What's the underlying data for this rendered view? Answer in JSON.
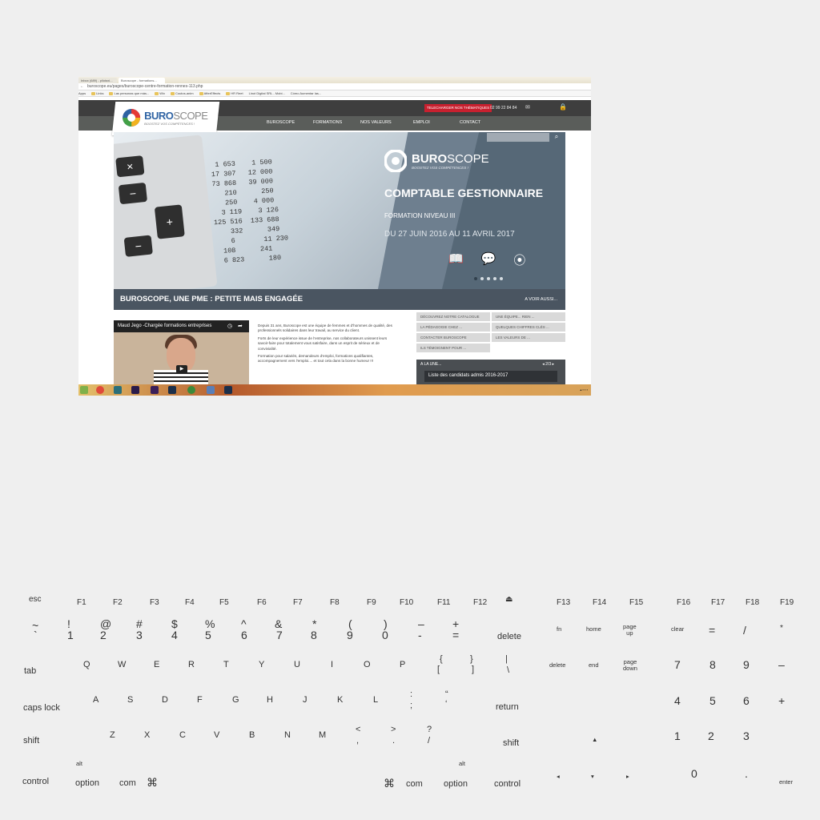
{
  "browser": {
    "tabs": [
      "Inbox (689) - pilotaxi...",
      "Buroscope - formations..."
    ],
    "url": "buroscope.eu/pages/buroscope-centre-formation-rennes-113.php",
    "bookmarks": [
      "Apps",
      "Links",
      "Las personas que más...",
      "Wix",
      "Coutos-anim",
      "AfterEffects",
      "HR Reet",
      "Linot Digital SRL - Mobi...",
      "Cómo Aumentar las..."
    ]
  },
  "site": {
    "download_button": "TELECHARGER NOS THÉMATIQUES",
    "phone": "02 99 22 84 84",
    "logo_name_bold": "BURO",
    "logo_name_light": "SCOPE",
    "logo_tagline": "BOOSTEZ VOS COMPÉTENCES !",
    "nav": [
      "BUROSCOPE",
      "FORMATIONS",
      "NOS VALEURS",
      "EMPLOI",
      "CONTACT"
    ],
    "hero": {
      "title": "COMPTABLE GESTIONNAIRE",
      "subtitle": "FORMATION NIVEAU III",
      "dates": "DU 27 JUIN 2016  AU 11 AVRIL 2017",
      "paper": "    1 653    1 500\n   17 307   12 000\n   73 868   39 000\n      210      250\n      250    4 000\n     3 119    3 126\n   125 516  133 688\n       332      349\n       6       11 230\n     108      241\n     6 823      180",
      "calc_keys": [
        "×",
        "−",
        "+",
        "−"
      ]
    },
    "banner": {
      "title": "BUROSCOPE, UNE PME : PETITE MAIS ENGAGÉE",
      "link": "A VOIR AUSSI..."
    },
    "video_title": "Maud Jego -Chargée formations entreprises",
    "body": [
      "Depuis 31 ans, Buroscope est une équipe de femmes et d'hommes de qualité, des professionnels solidaires dans leur travail, au service du client.",
      "Forts de leur expérience issue de l'entreprise, nos collaborateurs unissent leurs savoir-faire pour totalement vous satisfaire, dans un esprit de sérieux et de convivialité.",
      "Formation pour salariés, demandeurs d'emploi, formations qualifiantes, accompagnement vers l'emploi.... et tout cela dans la bonne humeur !!!"
    ],
    "links": [
      "DÉCOUVREZ NOTRE CATALOGUE",
      "UNE ÉQUIPE... RIEN ...",
      "LA PÉDAGOGIE CHEZ ...",
      "QUELQUES CHIFFRES CLÉS ...",
      "CONTACTER BUROSCOPE",
      "LES VALEURS DE ...",
      "ILS TÉMOIGNENT POUR ..."
    ],
    "alaune": {
      "label": "A LA UNE...",
      "pager": "◂ 2/3 ▸",
      "item": "Liste des candidats admis 2016-2017"
    }
  },
  "keyboard": {
    "fn_row": [
      "esc",
      "F1",
      "F2",
      "F3",
      "F4",
      "F5",
      "F6",
      "F7",
      "F8",
      "F9",
      "F10",
      "F11",
      "F12",
      "⏏",
      "F13",
      "F14",
      "F15",
      "F16",
      "F17",
      "F18",
      "F19"
    ],
    "num_row_top": [
      "~",
      "!",
      "@",
      "#",
      "$",
      "%",
      "^",
      "&",
      "*",
      "(",
      ")",
      "–",
      "+"
    ],
    "num_row_bot": [
      "`",
      "1",
      "2",
      "3",
      "4",
      "5",
      "6",
      "7",
      "8",
      "9",
      "0",
      "-",
      "="
    ],
    "delete": "delete",
    "q_row": [
      "Q",
      "W",
      "E",
      "R",
      "T",
      "Y",
      "U",
      "I",
      "O",
      "P"
    ],
    "a_row": [
      "A",
      "S",
      "D",
      "F",
      "G",
      "H",
      "J",
      "K",
      "L"
    ],
    "z_row": [
      "Z",
      "X",
      "C",
      "V",
      "B",
      "N",
      "M"
    ],
    "brackets": [
      "{",
      "}",
      "|",
      "[",
      "]",
      "\\"
    ],
    "semis": [
      ":",
      "“",
      ";",
      "‘"
    ],
    "angles": [
      "<",
      ">",
      "?",
      ",",
      ".",
      "/"
    ],
    "tab": "tab",
    "caps": "caps lock",
    "return": "return",
    "shift": "shift",
    "alt": "alt",
    "control": "control",
    "option": "option",
    "com": "com",
    "cmd": "⌘",
    "nav_keys": {
      "fn": "fn",
      "home": "home",
      "page_up": "page\nup",
      "delete": "delete",
      "end": "end",
      "page_down": "page\ndown"
    },
    "numpad": {
      "clear": "clear",
      "eq": "=",
      "div": "/",
      "mul": "*",
      "r1": [
        "7",
        "8",
        "9",
        "–"
      ],
      "r2": [
        "4",
        "5",
        "6",
        "+"
      ],
      "r3": [
        "1",
        "2",
        "3"
      ],
      "zero": "0",
      "dot": ".",
      "enter": "enter"
    },
    "arrows": {
      "up": "▲",
      "left": "◂",
      "down": "▾",
      "right": "▸"
    }
  }
}
